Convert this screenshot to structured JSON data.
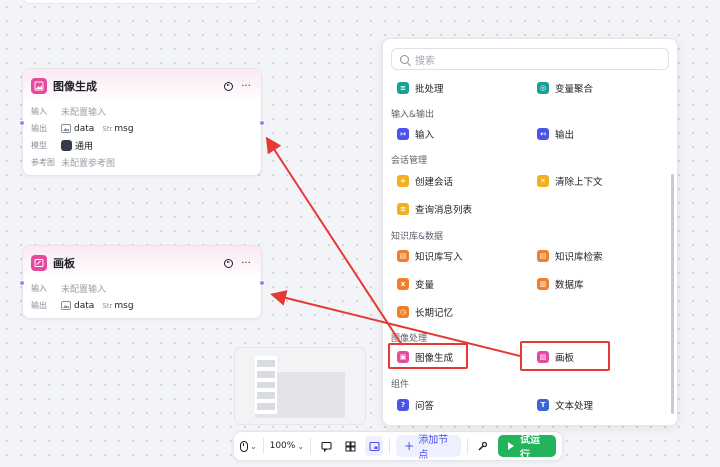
{
  "canvas": {
    "node_image_gen": {
      "title": "图像生成",
      "rows": [
        {
          "key": "输入",
          "value": "未配置输入"
        },
        {
          "key": "输出",
          "value": "data",
          "tag": "Str",
          "tag_value": "msg"
        },
        {
          "key": "模型",
          "value": "通用"
        },
        {
          "key": "参考图",
          "value": "未配置参考图"
        }
      ]
    },
    "node_canvas": {
      "title": "画板",
      "rows": [
        {
          "key": "输入",
          "value": "未配置输入"
        },
        {
          "key": "输出",
          "value": "data",
          "tag": "Str",
          "tag_value": "msg"
        }
      ]
    }
  },
  "toolbar": {
    "zoom": "100%",
    "add_node": "添加节点",
    "run": "试运行"
  },
  "panel": {
    "search_placeholder": "搜索",
    "top_items": [
      {
        "label": "批处理",
        "color": "#1aa196"
      },
      {
        "label": "变量聚合",
        "color": "#1aa196"
      }
    ],
    "sections": [
      {
        "title": "输入&输出",
        "items": [
          {
            "label": "输入",
            "color": "#4d53e8"
          },
          {
            "label": "输出",
            "color": "#4d53e8"
          }
        ]
      },
      {
        "title": "会话管理",
        "items": [
          {
            "label": "创建会话",
            "color": "#f2b01e"
          },
          {
            "label": "清除上下文",
            "color": "#f2b01e"
          },
          {
            "label": "查询消息列表",
            "color": "#f2b01e"
          }
        ]
      },
      {
        "title": "知识库&数据",
        "items": [
          {
            "label": "知识库写入",
            "color": "#f07e2a"
          },
          {
            "label": "知识库检索",
            "color": "#f07e2a"
          },
          {
            "label": "变量",
            "color": "#f07e2a"
          },
          {
            "label": "数据库",
            "color": "#f07e2a"
          },
          {
            "label": "长期记忆",
            "color": "#f07e2a"
          }
        ]
      },
      {
        "title": "图像处理",
        "items": [
          {
            "label": "图像生成",
            "color": "#e44a9d"
          },
          {
            "label": "画板",
            "color": "#e44a9d"
          }
        ]
      },
      {
        "title": "组件",
        "items": [
          {
            "label": "问答",
            "color": "#4d53e8"
          },
          {
            "label": "文本处理",
            "color": "#3b66d8"
          }
        ]
      }
    ]
  },
  "annotation_color": "#e53935"
}
